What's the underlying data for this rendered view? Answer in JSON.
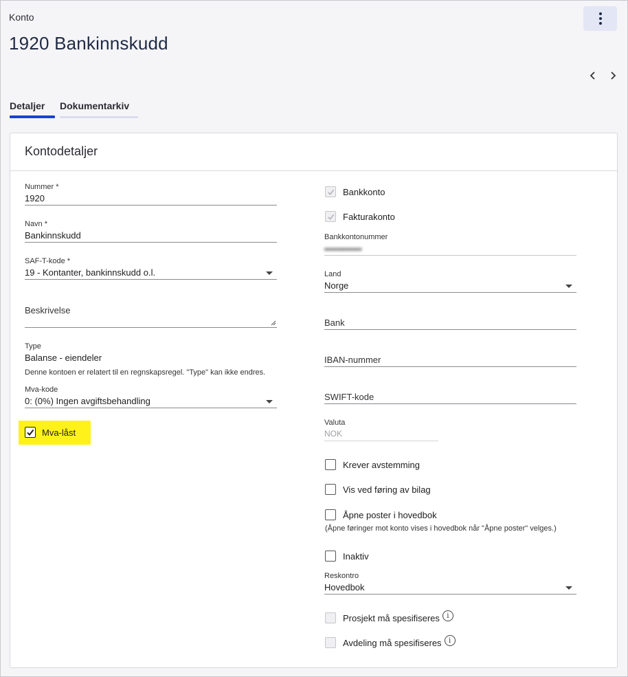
{
  "header": {
    "breadcrumb": "Konto",
    "title": "1920 Bankinnskudd",
    "menu_icon": "kebab-menu-icon",
    "prev_icon": "chevron-left-icon",
    "next_icon": "chevron-right-icon"
  },
  "tabs": [
    {
      "label": "Detaljer",
      "active": true
    },
    {
      "label": "Dokumentarkiv",
      "active": false
    }
  ],
  "colors": {
    "accent": "#1a3fd9",
    "tab_inactive_underline": "#dadcf0",
    "highlight": "#fff21a",
    "menu_button_bg": "#e3e6f5"
  },
  "card": {
    "title": "Kontodetaljer"
  },
  "left": {
    "nummer": {
      "label": "Nummer *",
      "value": "1920"
    },
    "navn": {
      "label": "Navn *",
      "value": "Bankinnskudd"
    },
    "saft": {
      "label": "SAF-T-kode *",
      "value": "19 - Kontanter, bankinnskudd o.l."
    },
    "beskrivelse": {
      "placeholder": "Beskrivelse"
    },
    "type": {
      "label": "Type",
      "value": "Balanse - eiendeler",
      "hint": "Denne kontoen er relatert til en regnskapsregel. \"Type\" kan ikke endres."
    },
    "mva": {
      "label": "Mva-kode",
      "value": "0: (0%) Ingen avgiftsbehandling"
    },
    "mva_last": {
      "label": "Mva-låst",
      "checked": true
    }
  },
  "right": {
    "bankkonto": {
      "label": "Bankkonto",
      "checked": true,
      "disabled": true
    },
    "fakturakonto": {
      "label": "Fakturakonto",
      "checked": true,
      "disabled": true
    },
    "bankkontonummer": {
      "label": "Bankkontonummer",
      "value": "••••••••••••"
    },
    "land": {
      "label": "Land",
      "value": "Norge"
    },
    "bank": {
      "placeholder": "Bank"
    },
    "iban": {
      "placeholder": "IBAN-nummer"
    },
    "swift": {
      "placeholder": "SWIFT-kode"
    },
    "valuta": {
      "label": "Valuta",
      "value": "NOK"
    },
    "krever": {
      "label": "Krever avstemming",
      "checked": false
    },
    "vis": {
      "label": "Vis ved føring av bilag",
      "checked": false
    },
    "apne": {
      "label": "Åpne poster i hovedbok",
      "checked": false,
      "hint": "(Åpne føringer mot konto vises i hovedbok når \"Åpne poster\" velges.)"
    },
    "inaktiv": {
      "label": "Inaktiv",
      "checked": false
    },
    "reskontro": {
      "label": "Reskontro",
      "value": "Hovedbok"
    },
    "prosjekt": {
      "label": "Prosjekt må spesifiseres",
      "checked": false,
      "disabled": true,
      "info_icon": "info-icon"
    },
    "avdeling": {
      "label": "Avdeling må spesifiseres",
      "checked": false,
      "disabled": true,
      "info_icon": "info-icon"
    }
  }
}
